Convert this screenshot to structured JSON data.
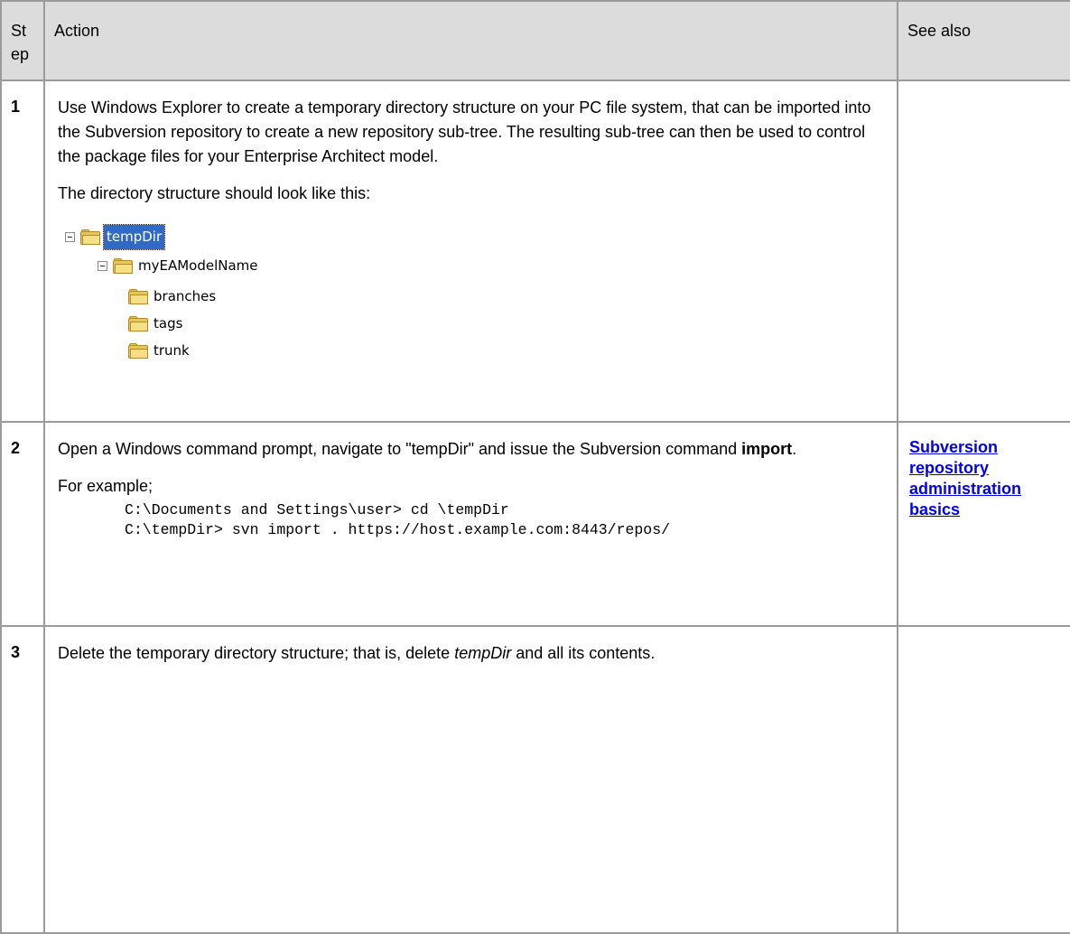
{
  "header": {
    "step": "St ep",
    "action": "Action",
    "see_also": "See also"
  },
  "rows": [
    {
      "num": "1",
      "p1": "Use Windows Explorer to create a temporary directory structure on your PC file system, that can be imported into the Subversion repository to create a new repository sub-tree.  The resulting sub-tree can then be used to control the package files for your Enterprise Architect model.",
      "p2": "The directory structure should look like this:",
      "tree": {
        "root": "tempDir",
        "model": "myEAModelName",
        "branches": "branches",
        "tags": "tags",
        "trunk": "trunk"
      }
    },
    {
      "num": "2",
      "text_a": "Open a Windows command prompt, navigate to \"tempDir\" and issue the Subversion command ",
      "text_bold": "import",
      "text_c": ".",
      "example": "For example;",
      "code1": "C:\\Documents and Settings\\user> cd \\tempDir",
      "code2": "C:\\tempDir> svn import . https://host.example.com:8443/repos/",
      "link": "Subversion repository administration basics"
    },
    {
      "num": "3",
      "text_a": "Delete the temporary directory structure; that is, delete ",
      "text_italic": "tempDir",
      "text_c": " and all its contents."
    }
  ]
}
